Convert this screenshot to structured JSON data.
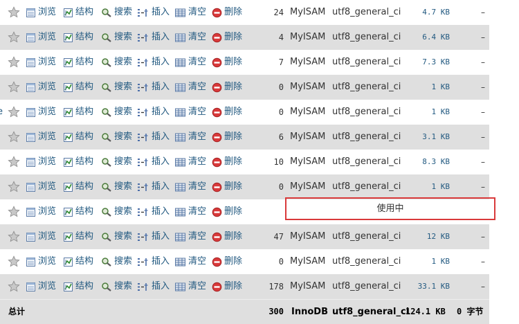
{
  "actions": {
    "browse": "浏览",
    "structure": "结构",
    "search": "搜索",
    "insert": "插入",
    "empty": "清空",
    "drop": "删除"
  },
  "clipped_left_char": "e",
  "rows": [
    {
      "rows": "24",
      "engine": "MyISAM",
      "collation": "utf8_general_ci",
      "size": "4.7 KB",
      "overhead": "–"
    },
    {
      "rows": "4",
      "engine": "MyISAM",
      "collation": "utf8_general_ci",
      "size": "6.4 KB",
      "overhead": "–"
    },
    {
      "rows": "7",
      "engine": "MyISAM",
      "collation": "utf8_general_ci",
      "size": "7.3 KB",
      "overhead": "–"
    },
    {
      "rows": "0",
      "engine": "MyISAM",
      "collation": "utf8_general_ci",
      "size": "1 KB",
      "overhead": "–"
    },
    {
      "rows": "0",
      "engine": "MyISAM",
      "collation": "utf8_general_ci",
      "size": "1 KB",
      "overhead": "–"
    },
    {
      "rows": "6",
      "engine": "MyISAM",
      "collation": "utf8_general_ci",
      "size": "3.1 KB",
      "overhead": "–"
    },
    {
      "rows": "10",
      "engine": "MyISAM",
      "collation": "utf8_general_ci",
      "size": "8.3 KB",
      "overhead": "–"
    },
    {
      "rows": "0",
      "engine": "MyISAM",
      "collation": "utf8_general_ci",
      "size": "1 KB",
      "overhead": "–"
    },
    {
      "in_use": "使用中"
    },
    {
      "rows": "47",
      "engine": "MyISAM",
      "collation": "utf8_general_ci",
      "size": "12 KB",
      "overhead": "–"
    },
    {
      "rows": "0",
      "engine": "MyISAM",
      "collation": "utf8_general_ci",
      "size": "1 KB",
      "overhead": "–"
    },
    {
      "rows": "178",
      "engine": "MyISAM",
      "collation": "utf8_general_ci",
      "size": "33.1 KB",
      "overhead": "–"
    }
  ],
  "footer": {
    "label": "总计",
    "rows": "300",
    "engine": "InnoDB",
    "collation": "utf8_general_ci",
    "size": "124.1 KB",
    "overhead": "0 字节"
  },
  "colors": {
    "link": "#235a81",
    "row_alt": "#dfdfdf",
    "highlight_border": "#d9393a",
    "drop_icon": "#d9393a"
  }
}
